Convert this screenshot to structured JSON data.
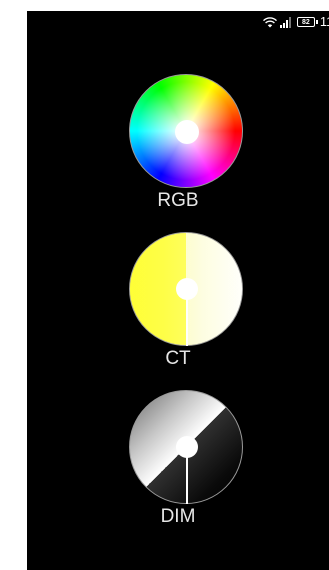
{
  "status_bar": {
    "time": "11:",
    "battery_level": "82",
    "icons": [
      "wifi-icon",
      "signal-icon",
      "battery-icon"
    ]
  },
  "wheels": [
    {
      "label": "RGB",
      "type": "color-wheel"
    },
    {
      "label": "CT",
      "type": "color-temperature-wheel"
    },
    {
      "label": "DIM",
      "type": "brightness-wheel"
    }
  ],
  "colors": {
    "background": "#000000",
    "label": "#e6e6e6",
    "ring": "#9a9a9a"
  }
}
